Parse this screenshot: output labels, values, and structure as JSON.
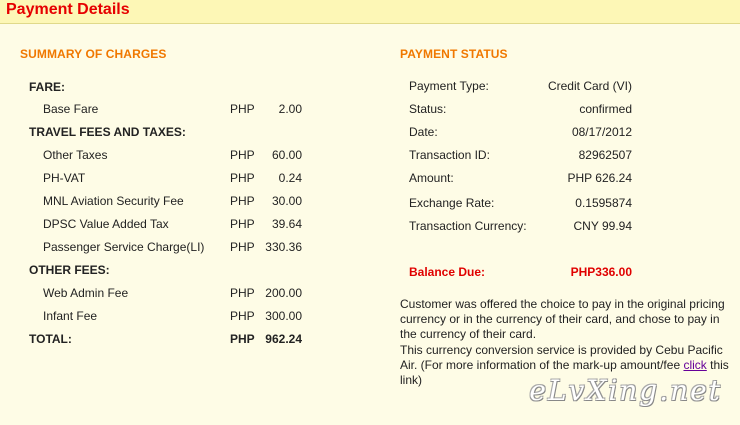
{
  "header": {
    "title": "Payment Details"
  },
  "summary": {
    "title": "SUMMARY OF CHARGES",
    "fare_heading": "FARE:",
    "fare_items": [
      {
        "label": "Base Fare",
        "currency": "PHP",
        "amount": "2.00"
      }
    ],
    "taxes_heading": "TRAVEL FEES AND TAXES:",
    "taxes_items": [
      {
        "label": "Other Taxes",
        "currency": "PHP",
        "amount": "60.00"
      },
      {
        "label": "PH-VAT",
        "currency": "PHP",
        "amount": "0.24"
      },
      {
        "label": "MNL Aviation Security Fee",
        "currency": "PHP",
        "amount": "30.00"
      },
      {
        "label": "DPSC Value Added Tax",
        "currency": "PHP",
        "amount": "39.64"
      },
      {
        "label": "Passenger Service Charge(LI)",
        "currency": "PHP",
        "amount": "330.36"
      }
    ],
    "other_heading": "OTHER FEES:",
    "other_items": [
      {
        "label": "Web Admin Fee",
        "currency": "PHP",
        "amount": "200.00"
      },
      {
        "label": "Infant Fee",
        "currency": "PHP",
        "amount": "300.00"
      }
    ],
    "total": {
      "label": "TOTAL:",
      "currency": "PHP",
      "amount": "962.24"
    }
  },
  "payment": {
    "title": "PAYMENT STATUS",
    "rows": [
      {
        "label": "Payment Type:",
        "value": "Credit Card (VI)"
      },
      {
        "label": "Status:",
        "value": "confirmed"
      },
      {
        "label": "Date:",
        "value": "08/17/2012"
      },
      {
        "label": "Transaction ID:",
        "value": "82962507"
      },
      {
        "label": "Amount:",
        "value": "PHP 626.24"
      },
      {
        "label": "Exchange Rate:",
        "value": "0.1595874"
      },
      {
        "label": "Transaction Currency:",
        "value": "CNY 99.94"
      }
    ],
    "balance_label": "Balance Due:",
    "balance_value": "PHP336.00",
    "note_part1": "Customer was offered the choice to pay in the original pricing currency or in the currency of their card, and chose to pay in the currency of their card.",
    "note_part2": "This currency conversion service is provided by Cebu Pacific Air.  (For more information of the mark-up amount/fee ",
    "note_link": "click",
    "note_part3": " this link)"
  },
  "watermark": "eLvXing.net",
  "colors": {
    "header_bg": "#fdf7b6",
    "title_red": "#e60000",
    "section_orange": "#f07800",
    "page_bg": "#fefce6"
  }
}
